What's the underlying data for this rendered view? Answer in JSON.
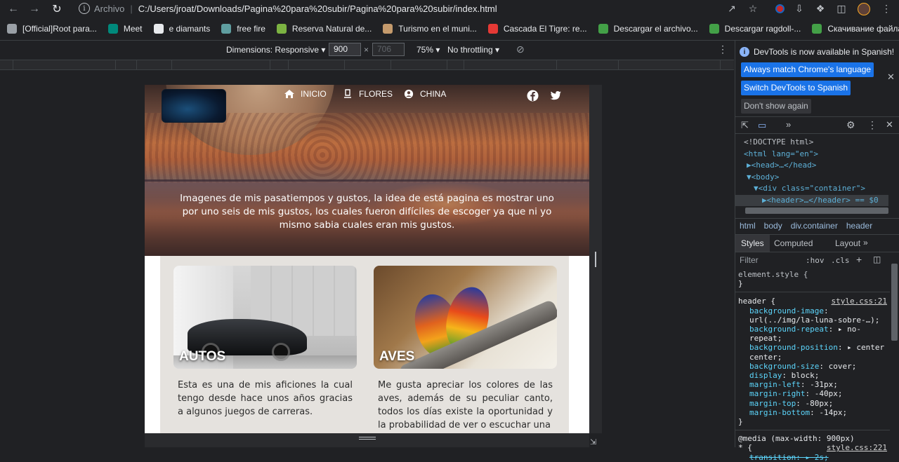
{
  "browser": {
    "site_label": "Archivo",
    "url": "C:/Users/jroat/Downloads/Pagina%20para%20subir/Pagina%20para%20subir/index.html"
  },
  "bookmarks": [
    {
      "label": "[Official]Root para...",
      "color": "#9aa0a6"
    },
    {
      "label": "Meet",
      "color": "#00897b"
    },
    {
      "label": "e diamants",
      "color": "#e8eaed"
    },
    {
      "label": "free fire",
      "color": "#5f9ea0"
    },
    {
      "label": "Reserva Natural de...",
      "color": "#7cb342"
    },
    {
      "label": "Turismo en el muni...",
      "color": "#c49a6c"
    },
    {
      "label": "Cascada El Tigre: re...",
      "color": "#e53935"
    },
    {
      "label": "Descargar el archivo...",
      "color": "#43a047"
    },
    {
      "label": "Descargar ragdoll-...",
      "color": "#43a047"
    },
    {
      "label": "Скачивание файла...",
      "color": "#43a047"
    }
  ],
  "device_toolbar": {
    "dimensions_label": "Dimensions: Responsive",
    "width": "900",
    "height": "706",
    "times": "×",
    "zoom": "75%",
    "throttling": "No throttling"
  },
  "site": {
    "nav": [
      {
        "label": "INICIO",
        "icon": "home-icon"
      },
      {
        "label": "FLORES",
        "icon": "flower-icon"
      },
      {
        "label": "CHINA",
        "icon": "user-circle-icon"
      }
    ],
    "hero_text": "Imagenes de mis pasatiempos y gustos, la idea de está pagina es mostrar uno por uno seis de mis gustos, los cuales fueron difíciles de escoger ya que ni yo mismo sabia cuales eran mis gustos.",
    "cards": [
      {
        "title": "AUTOS",
        "description": "Esta es una de mis aficiones la cual tengo desde hace unos años gracias a algunos juegos de carreras."
      },
      {
        "title": "AVES",
        "description": "Me gusta apreciar los colores de las aves, además de su peculiar canto, todos los días existe la oportunidad y la probabilidad de ver o escuchar una"
      }
    ]
  },
  "devtools": {
    "banner": "DevTools is now available in Spanish!",
    "btn_match": "Always match Chrome's language",
    "btn_switch": "Switch DevTools to Spanish",
    "btn_dont": "Don't show again",
    "dom": {
      "doctype": "<!DOCTYPE html>",
      "html_open": "<html lang=\"en\">",
      "head": "▶<head>…</head>",
      "body": "▼<body>",
      "div": "▼<div class=\"container\">",
      "header": "▶<header>…</header> == $0"
    },
    "breadcrumbs": [
      "html",
      "body",
      "div.container",
      "header"
    ],
    "tabs": [
      "Styles",
      "Computed",
      "Layout",
      "»"
    ],
    "filter_placeholder": "Filter",
    "hov": ":hov",
    "cls": ".cls",
    "styles": {
      "element_style": "element.style {",
      "close": "}",
      "selector": "header {",
      "source": "style.css:21",
      "props": [
        {
          "name": "background-image",
          "value": "url(../img/la-luna-sobre-…);"
        },
        {
          "name": "background-repeat",
          "value": "▸ no-repeat;"
        },
        {
          "name": "background-position",
          "value": "▸ center center;"
        },
        {
          "name": "background-size",
          "value": "cover;"
        },
        {
          "name": "display",
          "value": "block;"
        },
        {
          "name": "margin-left",
          "value": "-31px;"
        },
        {
          "name": "margin-right",
          "value": "-40px;"
        },
        {
          "name": "margin-top",
          "value": "-80px;"
        },
        {
          "name": "margin-bottom",
          "value": "-14px;"
        }
      ],
      "media": "@media (max-width: 900px)",
      "media_source": "style.css:221",
      "star": "* {",
      "transition": "transition: ▸ 2s;"
    }
  }
}
